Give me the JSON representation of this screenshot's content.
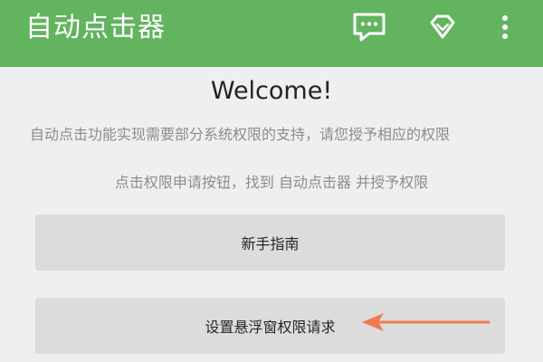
{
  "app_bar": {
    "title": "自动点击器",
    "background_color": "#62b45f",
    "actions": [
      {
        "icon": "chat-bubble-icon"
      },
      {
        "icon": "diamond-icon"
      },
      {
        "icon": "more-vertical-icon"
      }
    ]
  },
  "main": {
    "heading": "Welcome!",
    "description_line1": "自动点击功能实现需要部分系统权限的支持，请您授予相应的权限",
    "description_line2": "点击权限申请按钮，找到 自动点击器 并授予权限",
    "buttons": [
      {
        "label": "新手指南"
      },
      {
        "label": "设置悬浮窗权限请求"
      }
    ],
    "annotation": {
      "icon": "arrow-left-icon",
      "color": "#ef7b4d"
    }
  }
}
